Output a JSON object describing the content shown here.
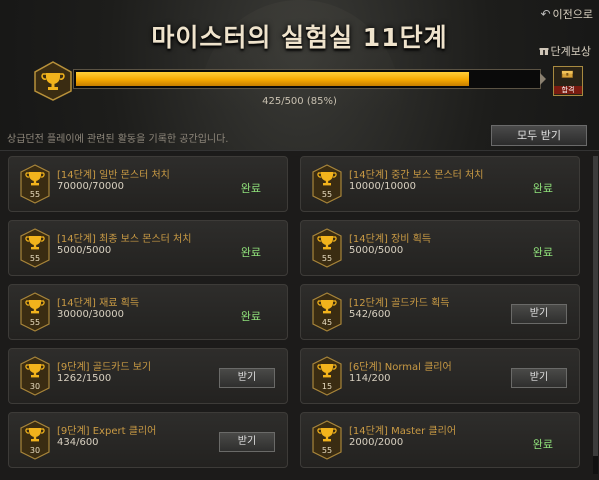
{
  "header": {
    "title": "마이스터의 실험실 11단계",
    "back_label": "이전으로",
    "stage_reward_label": "단계보상"
  },
  "progress": {
    "text": "425/500 (85%)",
    "fraction": 0.85,
    "chest_label": "합격"
  },
  "description": "상급던전 플레이에 관련된 활동을 기록한 공간입니다.",
  "claim_all_label": "모두 받기",
  "colors": {
    "accent_gold": "#f6a800",
    "complete_green": "#8fe07a",
    "quest_name": "#c99a44"
  },
  "quests": [
    {
      "name": "[14단계] 일반 몬스터 처치",
      "progress": "70000/70000",
      "level": "55",
      "status": "완료",
      "claimable": false
    },
    {
      "name": "[14단계] 중간 보스 몬스터 처치",
      "progress": "10000/10000",
      "level": "55",
      "status": "완료",
      "claimable": false
    },
    {
      "name": "[14단계] 최종 보스 몬스터 처치",
      "progress": "5000/5000",
      "level": "55",
      "status": "완료",
      "claimable": false
    },
    {
      "name": "[14단계] 장비 획득",
      "progress": "5000/5000",
      "level": "55",
      "status": "완료",
      "claimable": false
    },
    {
      "name": "[14단계] 재료 획득",
      "progress": "30000/30000",
      "level": "55",
      "status": "완료",
      "claimable": false
    },
    {
      "name": "[12단계] 골드카드 획득",
      "progress": "542/600",
      "level": "45",
      "status": "받기",
      "claimable": true
    },
    {
      "name": "[9단계] 골드카드 보기",
      "progress": "1262/1500",
      "level": "30",
      "status": "받기",
      "claimable": true
    },
    {
      "name": "[6단계] Normal 클리어",
      "progress": "114/200",
      "level": "15",
      "status": "받기",
      "claimable": true
    },
    {
      "name": "[9단계] Expert 클리어",
      "progress": "434/600",
      "level": "30",
      "status": "받기",
      "claimable": true
    },
    {
      "name": "[14단계] Master 클리어",
      "progress": "2000/2000",
      "level": "55",
      "status": "완료",
      "claimable": false
    }
  ]
}
